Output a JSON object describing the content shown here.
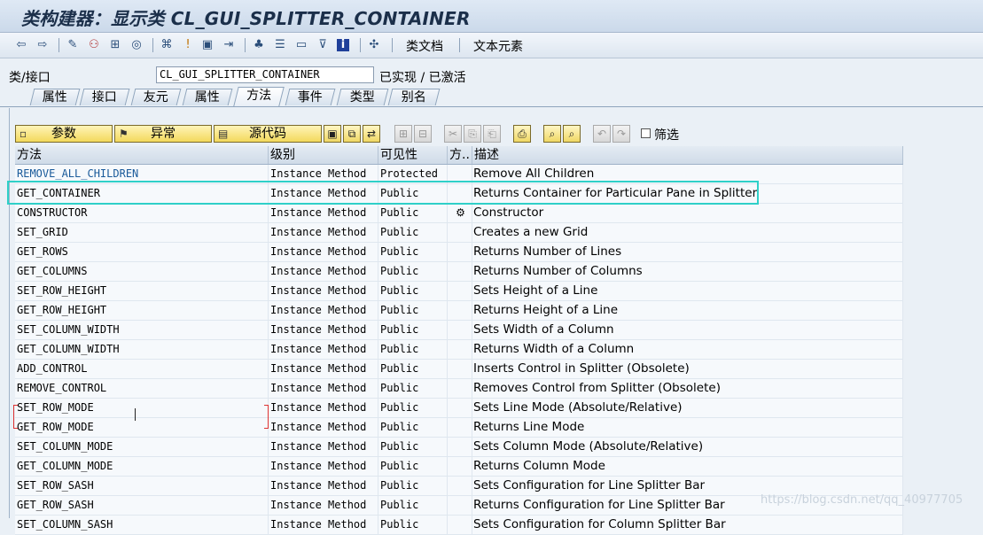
{
  "window": {
    "title": "类构建器：显示类 CL_GUI_SPLITTER_CONTAINER"
  },
  "toolbar": {
    "icons": [
      "back-icon",
      "forward-icon",
      "edit-icon",
      "switch-icon",
      "object-icon",
      "where-used-icon",
      "hierarchy-icon",
      "activate-icon",
      "display-icon",
      "navigate-icon",
      "tree-icon",
      "list-icon",
      "window-icon",
      "filter-icon",
      "info-icon",
      "settings-icon"
    ],
    "class_doc_label": "类文档",
    "text_elements_label": "文本元素"
  },
  "class_field": {
    "label": "类/接口",
    "value": "CL_GUI_SPLITTER_CONTAINER",
    "status": "已实现 / 已激活"
  },
  "tabs": [
    {
      "label": "属性",
      "active": false
    },
    {
      "label": "接口",
      "active": false
    },
    {
      "label": "友元",
      "active": false
    },
    {
      "label": "属性",
      "active": false
    },
    {
      "label": "方法",
      "active": true
    },
    {
      "label": "事件",
      "active": false
    },
    {
      "label": "类型",
      "active": false
    },
    {
      "label": "别名",
      "active": false
    }
  ],
  "panel_toolbar": {
    "params_label": "参数",
    "exceptions_label": "异常",
    "source_label": "源代码",
    "filter_label": "筛选"
  },
  "table": {
    "headers": [
      "方法",
      "级别",
      "可见性",
      "方..",
      "描述"
    ],
    "rows": [
      {
        "name": "REMOVE_ALL_CHILDREN",
        "level": "Instance Method",
        "visibility": "Protected",
        "type": "",
        "desc": "Remove All Children"
      },
      {
        "name": "GET_CONTAINER",
        "level": "Instance Method",
        "visibility": "Public",
        "type": "",
        "desc": "Returns Container for Particular Pane in Splitter"
      },
      {
        "name": "CONSTRUCTOR",
        "level": "Instance Method",
        "visibility": "Public",
        "type": "⚙",
        "desc": "Constructor"
      },
      {
        "name": "SET_GRID",
        "level": "Instance Method",
        "visibility": "Public",
        "type": "",
        "desc": "Creates a new Grid"
      },
      {
        "name": "GET_ROWS",
        "level": "Instance Method",
        "visibility": "Public",
        "type": "",
        "desc": "Returns Number of Lines"
      },
      {
        "name": "GET_COLUMNS",
        "level": "Instance Method",
        "visibility": "Public",
        "type": "",
        "desc": "Returns Number of Columns"
      },
      {
        "name": "SET_ROW_HEIGHT",
        "level": "Instance Method",
        "visibility": "Public",
        "type": "",
        "desc": "Sets Height of a Line"
      },
      {
        "name": "GET_ROW_HEIGHT",
        "level": "Instance Method",
        "visibility": "Public",
        "type": "",
        "desc": "Returns Height of a Line"
      },
      {
        "name": "SET_COLUMN_WIDTH",
        "level": "Instance Method",
        "visibility": "Public",
        "type": "",
        "desc": "Sets Width of a Column"
      },
      {
        "name": "GET_COLUMN_WIDTH",
        "level": "Instance Method",
        "visibility": "Public",
        "type": "",
        "desc": "Returns Width of a Column"
      },
      {
        "name": "ADD_CONTROL",
        "level": "Instance Method",
        "visibility": "Public",
        "type": "",
        "desc": "Inserts Control in Splitter (Obsolete)"
      },
      {
        "name": "REMOVE_CONTROL",
        "level": "Instance Method",
        "visibility": "Public",
        "type": "",
        "desc": "Removes Control from Splitter (Obsolete)"
      },
      {
        "name": "SET_ROW_MODE",
        "level": "Instance Method",
        "visibility": "Public",
        "type": "",
        "desc": "Sets Line Mode (Absolute/Relative)"
      },
      {
        "name": "GET_ROW_MODE",
        "level": "Instance Method",
        "visibility": "Public",
        "type": "",
        "desc": "Returns Line Mode"
      },
      {
        "name": "SET_COLUMN_MODE",
        "level": "Instance Method",
        "visibility": "Public",
        "type": "",
        "desc": "Sets Column Mode (Absolute/Relative)"
      },
      {
        "name": "GET_COLUMN_MODE",
        "level": "Instance Method",
        "visibility": "Public",
        "type": "",
        "desc": "Returns Column Mode"
      },
      {
        "name": "SET_ROW_SASH",
        "level": "Instance Method",
        "visibility": "Public",
        "type": "",
        "desc": "Sets Configuration for Line Splitter Bar"
      },
      {
        "name": "GET_ROW_SASH",
        "level": "Instance Method",
        "visibility": "Public",
        "type": "",
        "desc": "Returns Configuration for Line Splitter Bar"
      },
      {
        "name": "SET_COLUMN_SASH",
        "level": "Instance Method",
        "visibility": "Public",
        "type": "",
        "desc": "Sets Configuration for Column Splitter Bar"
      }
    ]
  },
  "watermark": "https://blog.csdn.net/qq_40977705",
  "colors": {
    "highlight": "#2fd0c8",
    "button": "#f3d95c",
    "link": "#1a5a9a"
  }
}
